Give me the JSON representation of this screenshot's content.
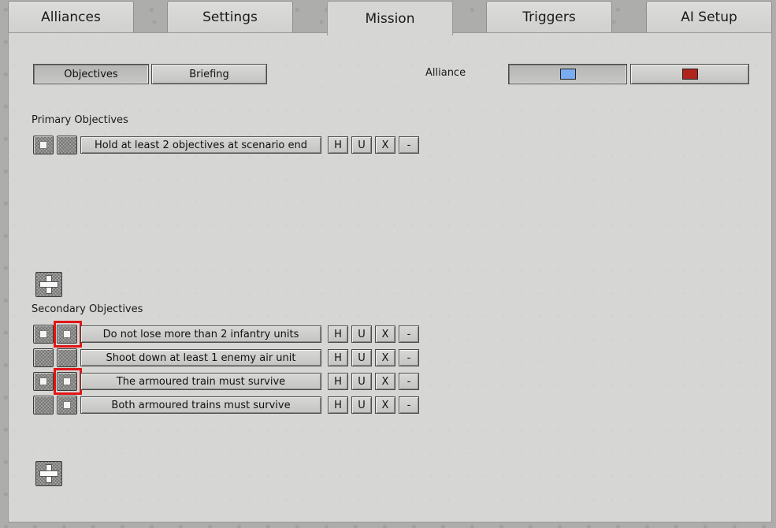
{
  "tabs": [
    {
      "label": "Alliances"
    },
    {
      "label": "Settings"
    },
    {
      "label": "Mission"
    },
    {
      "label": "Triggers"
    },
    {
      "label": "AI Setup"
    }
  ],
  "subtabs": {
    "objectives": "Objectives",
    "briefing": "Briefing"
  },
  "alliance": {
    "label": "Alliance",
    "colors": [
      "#7aacf0",
      "#b0241c"
    ]
  },
  "primary": {
    "heading": "Primary Objectives",
    "rows": [
      {
        "text": "Hold at least 2 objectives at scenario end"
      }
    ]
  },
  "secondary": {
    "heading": "Secondary Objectives",
    "rows": [
      {
        "text": "Do not lose more than 2 infantry units"
      },
      {
        "text": "Shoot down at least 1 enemy air unit"
      },
      {
        "text": "The armoured train must survive"
      },
      {
        "text": "Both armoured trains must survive"
      }
    ]
  },
  "row_buttons": {
    "h": "H",
    "u": "U",
    "x": "X",
    "remove": "-"
  }
}
